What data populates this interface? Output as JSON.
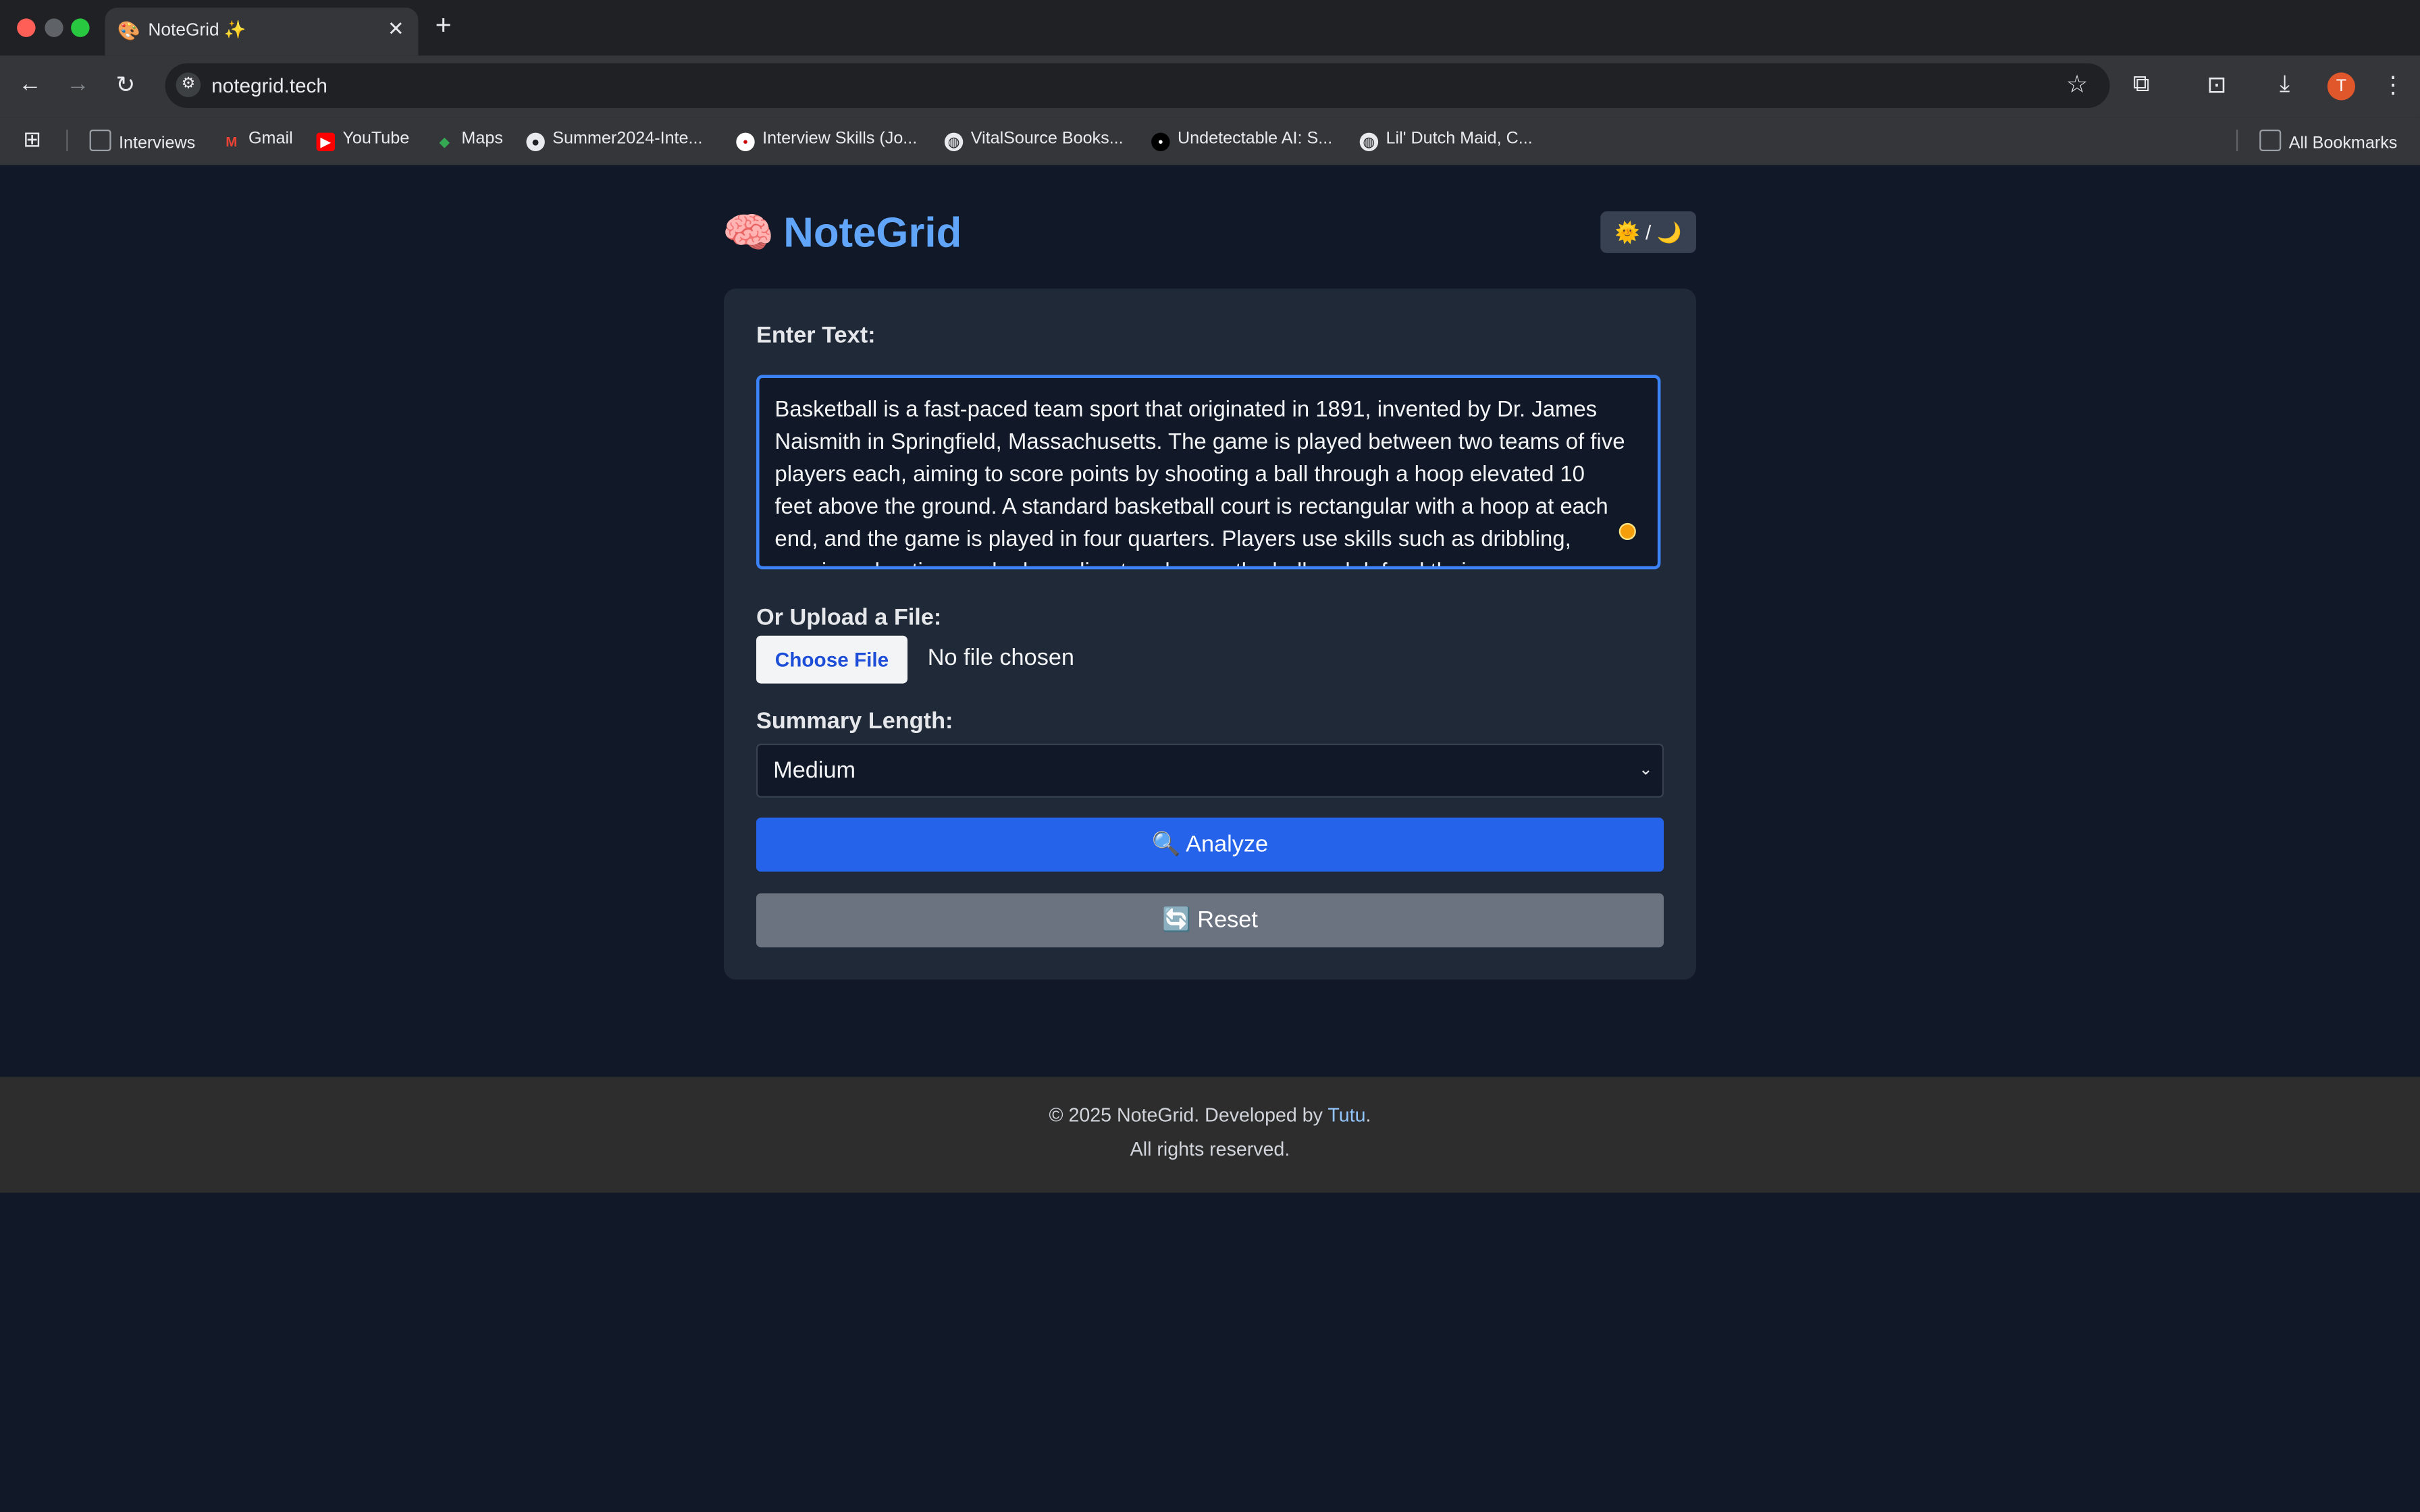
{
  "browser": {
    "tab_title": "NoteGrid ✨",
    "tab_favicon": "🎨",
    "url": "notegrid.tech",
    "avatar_letter": "T",
    "bookmarks": [
      {
        "label": "Interviews",
        "icon": "folder-icon"
      },
      {
        "label": "Gmail",
        "icon": "gmail-icon"
      },
      {
        "label": "YouTube",
        "icon": "youtube-icon"
      },
      {
        "label": "Maps",
        "icon": "maps-icon"
      },
      {
        "label": "Summer2024-Inte...",
        "icon": "github-icon"
      },
      {
        "label": "Interview Skills (Jo...",
        "icon": "site-icon"
      },
      {
        "label": "VitalSource Books...",
        "icon": "globe-icon"
      },
      {
        "label": "Undetectable AI: S...",
        "icon": "site-icon"
      },
      {
        "label": "Lil' Dutch Maid, C...",
        "icon": "globe-icon"
      }
    ],
    "all_bookmarks": "All Bookmarks"
  },
  "app": {
    "brand_emoji": "🧠",
    "brand_name": "NoteGrid",
    "theme_toggle": "🌞 / 🌙",
    "enter_text_label": "Enter Text:",
    "text_value": "Basketball is a fast-paced team sport that originated in 1891, invented by Dr. James Naismith in Springfield, Massachusetts. The game is played between two teams of five players each, aiming to score points by shooting a ball through a hoop elevated 10 feet above the ground. A standard basketball court is rectangular with a hoop at each end, and the game is played in four quarters. Players use skills such as dribbling, passing, shooting, and rebounding to advance the ball and defend their",
    "upload_label": "Or Upload a File:",
    "choose_file": "Choose File",
    "file_status": "No file chosen",
    "summary_label": "Summary Length:",
    "summary_selected": "Medium",
    "analyze_label": "🔍 Analyze",
    "reset_label": "🔄 Reset"
  },
  "footer": {
    "line1_prefix": "© 2025 NoteGrid. Developed by ",
    "developer": "Tutu",
    "line1_suffix": ".",
    "line2": "All rights reserved."
  },
  "colors": {
    "page_bg": "#111827",
    "card_bg": "#1f2937",
    "brand": "#60a5fa",
    "primary": "#2563eb",
    "secondary": "#6b7280"
  }
}
